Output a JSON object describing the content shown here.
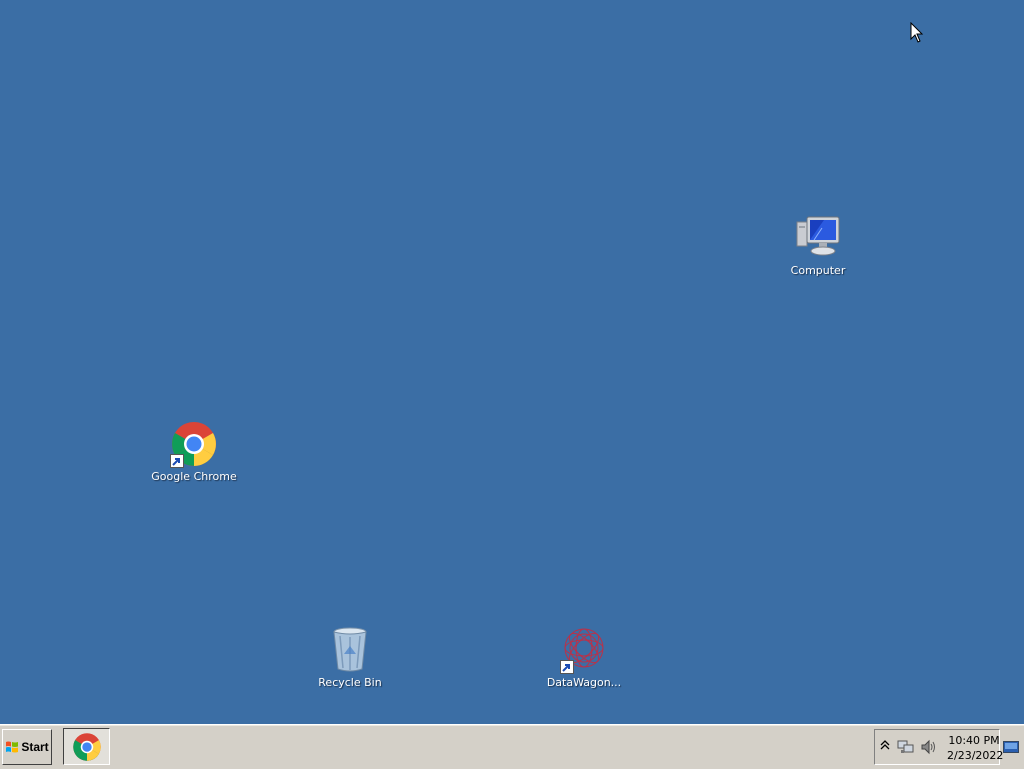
{
  "desktop": {
    "background_color": "#3b6ea5",
    "icons": [
      {
        "name": "computer",
        "label": "Computer",
        "icon": "computer-icon"
      },
      {
        "name": "google-chrome",
        "label": "Google Chrome",
        "icon": "chrome-icon",
        "shortcut": true
      },
      {
        "name": "recycle-bin",
        "label": "Recycle Bin",
        "icon": "recycle-bin-icon"
      },
      {
        "name": "datawagon",
        "label": "DataWagon...",
        "icon": "datawagon-icon",
        "shortcut": true
      }
    ]
  },
  "taskbar": {
    "start_label": "Start",
    "pinned": [
      {
        "name": "chrome",
        "icon": "chrome-icon"
      }
    ],
    "tray": {
      "icons": [
        "chevron-up-icon",
        "network-icon",
        "volume-icon"
      ],
      "time": "10:40 PM",
      "date": "2/23/2022"
    },
    "show_desktop_icon": "show-desktop-icon"
  }
}
